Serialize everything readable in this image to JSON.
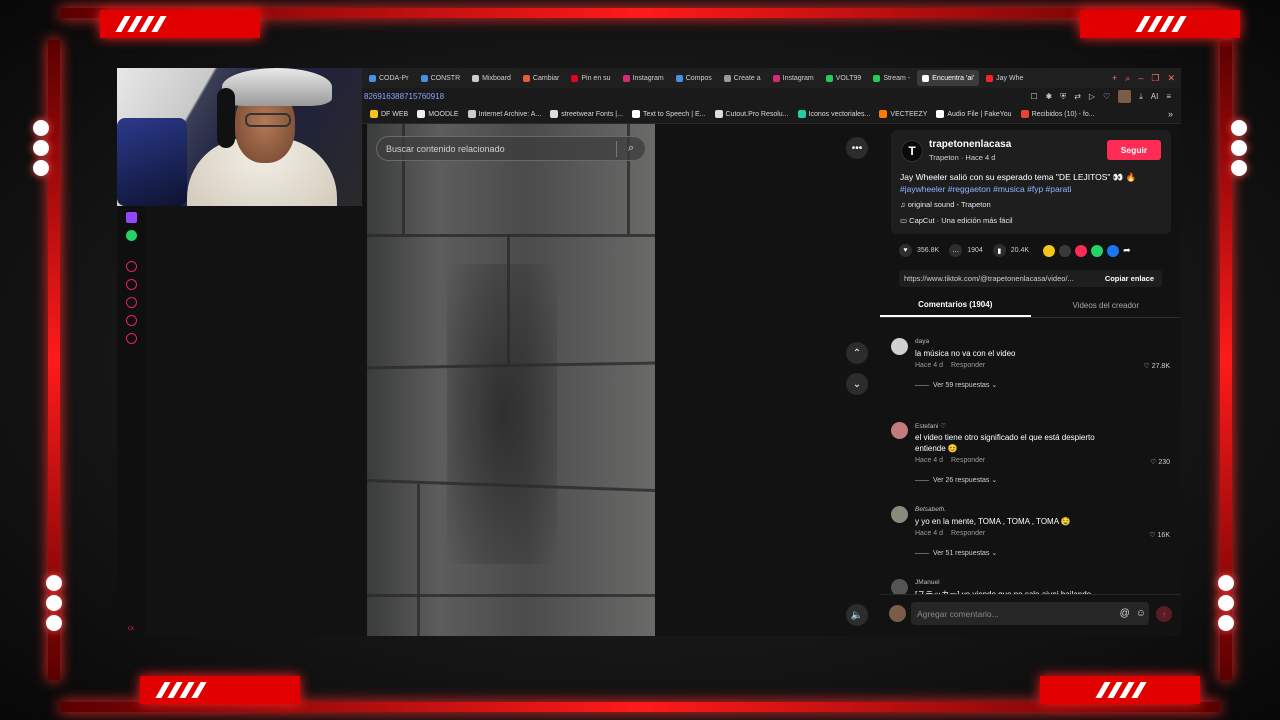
{
  "browser": {
    "tabs": [
      {
        "label": "CODA-Pr",
        "color": "#4a90e2",
        "active": false
      },
      {
        "label": "CONSTR",
        "color": "#4a90e2",
        "active": false
      },
      {
        "label": "Mixboard",
        "color": "#cccccc",
        "active": false
      },
      {
        "label": "Cambiar",
        "color": "#e06030",
        "active": false
      },
      {
        "label": "Pin en su",
        "color": "#e60023",
        "active": false
      },
      {
        "label": "Instagram",
        "color": "#d62976",
        "active": false
      },
      {
        "label": "Compos",
        "color": "#4a90e2",
        "active": false
      },
      {
        "label": "Create a",
        "color": "#999999",
        "active": false
      },
      {
        "label": "Instagram",
        "color": "#d62976",
        "active": false
      },
      {
        "label": "VOLT99",
        "color": "#22cc55",
        "active": false
      },
      {
        "label": "Stream -",
        "color": "#22cc55",
        "active": false
      },
      {
        "label": "Encuentra 'ai'",
        "color": "#ffffff",
        "active": true
      },
      {
        "label": "Jay Whe",
        "color": "#ff2222",
        "active": false
      }
    ],
    "url": "826916388715760918",
    "url_icons": [
      "bookmark-icon",
      "puzzle-icon",
      "shield-icon",
      "translate-icon",
      "play-icon",
      "heart-icon"
    ],
    "ai_label": "AI",
    "bookmarks": [
      {
        "label": "DF WEB",
        "color": "#f5c518"
      },
      {
        "label": "MOODLE",
        "color": "#f0f0f0"
      },
      {
        "label": "Internet Archive: A...",
        "color": "#cccccc"
      },
      {
        "label": "streetwear Fonts |...",
        "color": "#dddddd"
      },
      {
        "label": "Text to Speech | E...",
        "color": "#ffffff"
      },
      {
        "label": "Cutout.Pro Resolu...",
        "color": "#dddddd"
      },
      {
        "label": "Iconos vectoriales...",
        "color": "#22ccaa"
      },
      {
        "label": "VECTEEZY",
        "color": "#ff7a00"
      },
      {
        "label": "Audio File | FakeYou",
        "color": "#ffffff"
      },
      {
        "label": "Recibidos (10) - fo...",
        "color": "#ea4335"
      }
    ],
    "bookmarks_more": "»"
  },
  "sidebar": {
    "bottom_text": "cx"
  },
  "video": {
    "search_placeholder": "Buscar contenido relacionado",
    "search_icon": "⌕",
    "more_icon": "•••",
    "up_icon": "⌃",
    "down_icon": "⌄",
    "volume_icon": "🔈"
  },
  "author": {
    "avatar_letter": "T",
    "name": "trapetonenlacasa",
    "meta": "Trapeton · Hace 4 d",
    "follow_label": "Seguir",
    "description": "Jay Wheeler salió con su esperado tema \"DE LEJITOS\" 👀 🔥",
    "hashtags": "#jaywheeler #reggaeton #musica #fyp #parati",
    "sound": "original sound - Trapeton",
    "capcut": "CapCut · Una edición más fácil"
  },
  "stats": {
    "likes": "356.8K",
    "comments": "1904",
    "saves": "20.4K"
  },
  "link": {
    "url": "https://www.tiktok.com/@trapetonenlacasa/video/...",
    "copy_label": "Copiar enlace"
  },
  "tabs": {
    "comments": "Comentarios (1904)",
    "creator_videos": "Videos del creador"
  },
  "comments": [
    {
      "user": "daya",
      "text": "la música no va con el video",
      "time": "Hace 4 d",
      "reply": "Responder",
      "likes": "27.8K",
      "more": "Ver 59 respuestas ⌄",
      "avatar_color": "#d0d0d0"
    },
    {
      "user": "Estefani ♡",
      "text": "el video tiene otro significado el que está despierto entiende 😊",
      "time": "Hace 4 d",
      "reply": "Responder",
      "likes": "230",
      "more": "Ver 26 respuestas ⌄",
      "avatar_color": "#c27a7a"
    },
    {
      "user": "Betsabeth.",
      "text": "y yo en la mente, TOMA , TOMA , TOMA 🤤",
      "time": "Hace 4 d",
      "reply": "Responder",
      "likes": "16K",
      "more": "Ver 51 respuestas ⌄",
      "avatar_color": "#8a8a7a"
    },
    {
      "user": "JManuel",
      "text": "[ステッカー] yo viendo que no sale aiuni bailando",
      "time": "",
      "reply": "",
      "likes": "",
      "more": "",
      "avatar_color": "#555555"
    }
  ],
  "comment_bar": {
    "placeholder": "Agregar comentario...",
    "mention_icon": "@",
    "emoji_icon": "☺",
    "send_icon": "↑"
  }
}
